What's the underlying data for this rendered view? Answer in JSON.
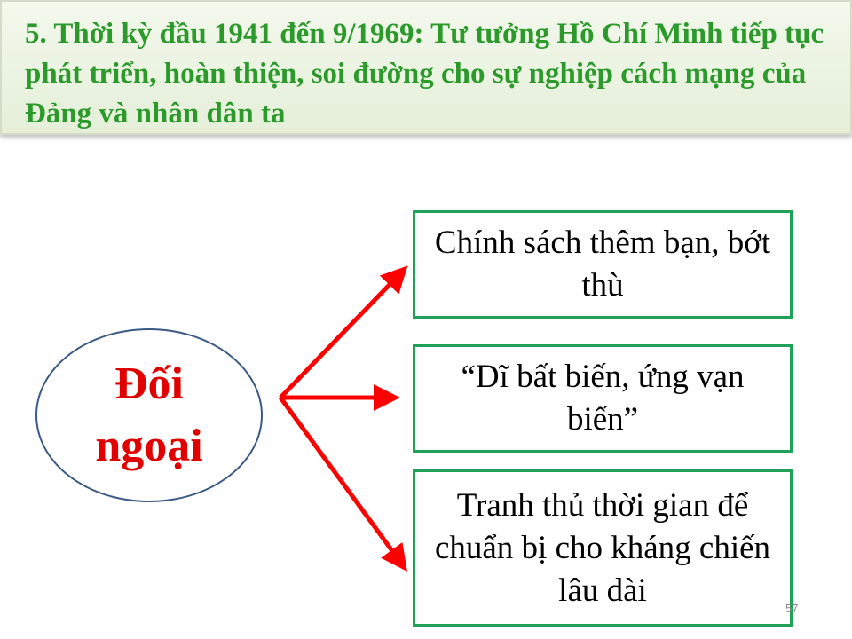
{
  "title": "5. Thời kỳ đầu 1941 đến 9/1969: Tư tưởng Hồ Chí Minh tiếp tục phát triển, hoàn thiện, soi đường cho sự nghiệp cách mạng của Đảng và nhân dân ta",
  "center": {
    "label": "Đối ngoại"
  },
  "branches": [
    {
      "label": "Chính sách thêm bạn, bớt thù"
    },
    {
      "label": "“Dĩ bất biến, ứng vạn biến”"
    },
    {
      "label": "Tranh thủ thời gian để chuẩn bị cho kháng chiến lâu dài"
    }
  ],
  "page_number": "57",
  "colors": {
    "title_text": "#2b9a2b",
    "title_bg": "#e9f2de",
    "center_text": "#e00000",
    "ellipse_border": "#3a5a85",
    "box_border": "#1fa257",
    "arrow": "#ff0000"
  }
}
